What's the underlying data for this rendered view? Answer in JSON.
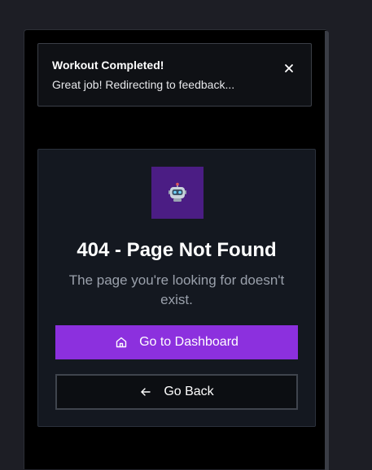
{
  "toast": {
    "title": "Workout Completed!",
    "message": "Great job! Redirecting to feedback...",
    "close_icon": "close-icon"
  },
  "error_page": {
    "avatar_icon": "robot-emoji",
    "avatar_glyph": "🤖",
    "avatar_bg": "#4b1d84",
    "heading": "404 - Page Not Found",
    "description": "The page you're looking for doesn't exist."
  },
  "buttons": {
    "dashboard": {
      "label": "Go to Dashboard",
      "icon": "home-icon",
      "color": "#8c30de"
    },
    "back": {
      "label": "Go Back",
      "icon": "arrow-left-icon"
    }
  },
  "colors": {
    "page_bg": "#1d1e25",
    "card_bg": "#141820",
    "accent": "#8c30de"
  }
}
